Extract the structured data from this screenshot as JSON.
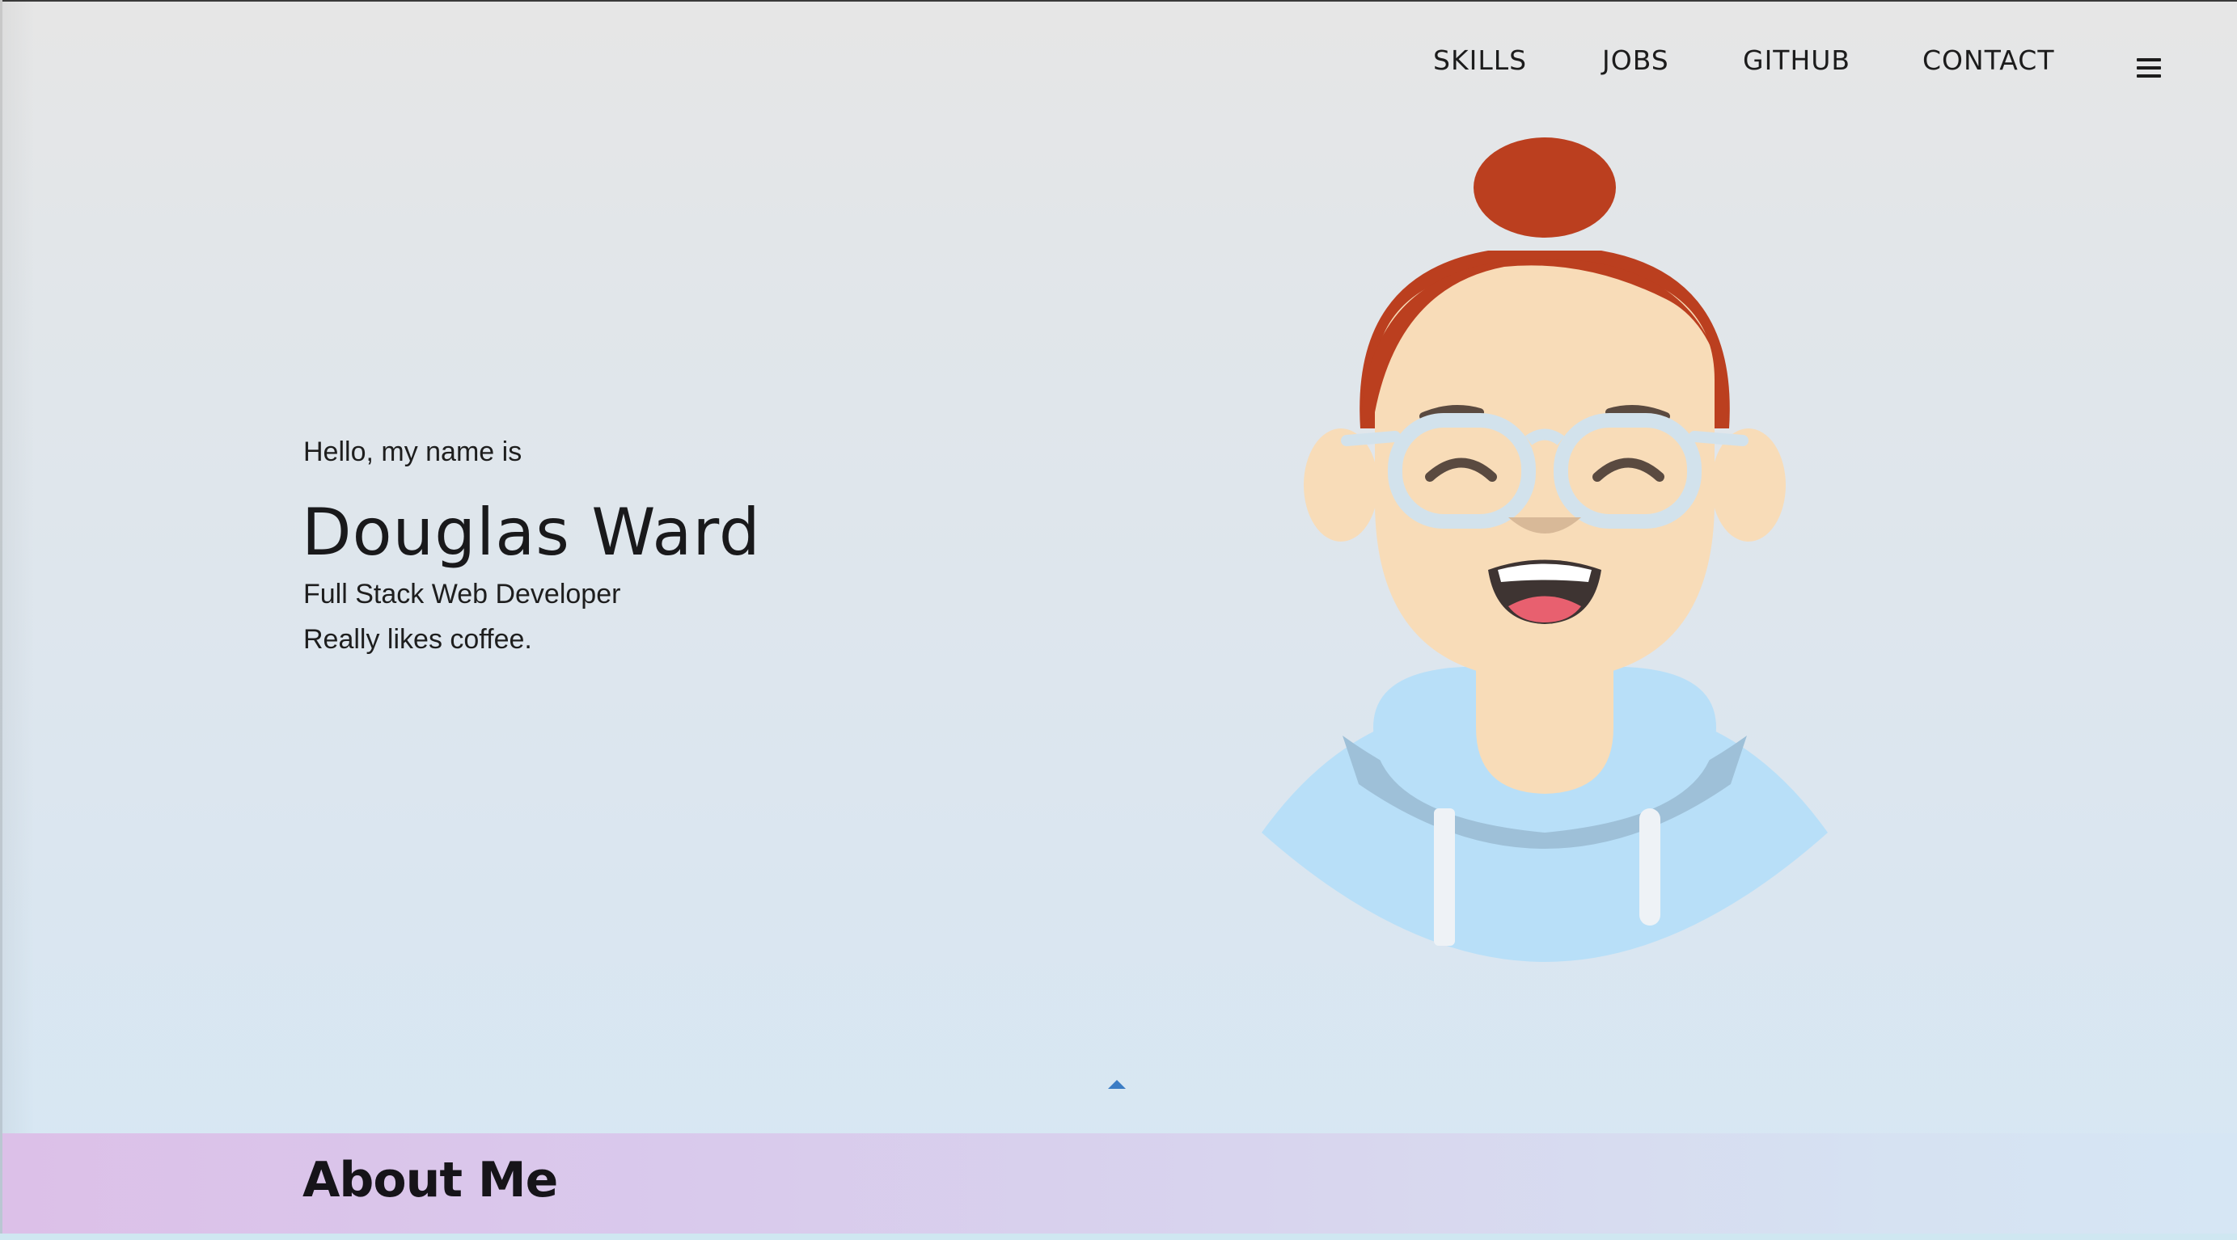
{
  "nav": {
    "links": [
      {
        "label": "SKILLS"
      },
      {
        "label": "JOBS"
      },
      {
        "label": "GITHUB"
      },
      {
        "label": "CONTACT"
      }
    ],
    "menu_icon": "hamburger-menu-icon"
  },
  "hero": {
    "greeting": "Hello, my name is",
    "name": "Douglas Ward",
    "title": "Full Stack Web Developer",
    "tagline": "Really likes coffee."
  },
  "scroll_icon": "caret-up-icon",
  "about": {
    "heading": "About Me"
  },
  "colors": {
    "hair": "#bb3f1f",
    "skin": "#f8dcb8",
    "hoodie": "#b8dff8",
    "glasses": "#d2e2ec",
    "accent": "#3b7cc4",
    "about_gradient_start": "#dcc0e8",
    "about_gradient_end": "#d6e6f4"
  }
}
